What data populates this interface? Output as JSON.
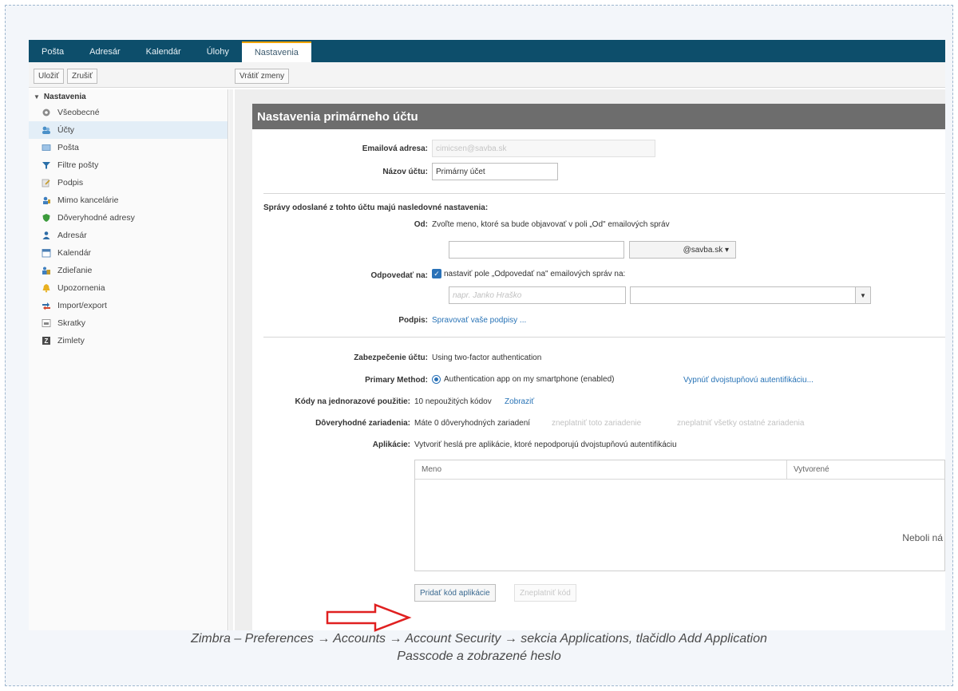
{
  "nav": {
    "tabs": [
      {
        "label": "Pošta"
      },
      {
        "label": "Adresár"
      },
      {
        "label": "Kalendár"
      },
      {
        "label": "Úlohy"
      },
      {
        "label": "Nastavenia"
      }
    ]
  },
  "toolbar": {
    "save_label": "Uložiť",
    "cancel_label": "Zrušiť",
    "revert_label": "Vrátiť zmeny"
  },
  "sidebar": {
    "header": "Nastavenia",
    "items": [
      {
        "label": "Všeobecné",
        "icon": "gear-icon"
      },
      {
        "label": "Účty",
        "icon": "accounts-icon"
      },
      {
        "label": "Pošta",
        "icon": "mail-icon"
      },
      {
        "label": "Filtre pošty",
        "icon": "filter-icon"
      },
      {
        "label": "Podpis",
        "icon": "signature-icon"
      },
      {
        "label": "Mimo kancelárie",
        "icon": "out-of-office-icon"
      },
      {
        "label": "Dôveryhodné adresy",
        "icon": "shield-icon"
      },
      {
        "label": "Adresár",
        "icon": "contacts-icon"
      },
      {
        "label": "Kalendár",
        "icon": "calendar-icon"
      },
      {
        "label": "Zdieľanie",
        "icon": "sharing-icon"
      },
      {
        "label": "Upozornenia",
        "icon": "bell-icon"
      },
      {
        "label": "Import/export",
        "icon": "import-export-icon"
      },
      {
        "label": "Skratky",
        "icon": "keyboard-icon"
      },
      {
        "label": "Zimlety",
        "icon": "zimlet-icon"
      }
    ]
  },
  "panel": {
    "title": "Nastavenia primárneho účtu",
    "email_label": "Emailová adresa:",
    "email_value": "cimicsen@savba.sk",
    "account_name_label": "Názov účtu:",
    "account_name_value": "Primárny účet",
    "sent_section": "Správy odoslané z tohto účtu majú nasledovné nastavenia:",
    "from_label": "Od:",
    "from_text": "Zvoľte meno, ktoré sa bude objavovať v poli „Od\" emailových správ",
    "domain_select": "@savba.sk ▾",
    "reply_to_label": "Odpovedať na:",
    "reply_to_text": "nastaviť pole „Odpovedať na\" emailových správ na:",
    "reply_placeholder": "napr. Janko Hraško",
    "signature_label": "Podpis:",
    "signature_link": "Spravovať vaše podpisy ...",
    "security_label": "Zabezpečenie účtu:",
    "security_value": "Using two-factor authentication",
    "primary_method_label": "Primary Method:",
    "primary_method_value": "Authentication app on my smartphone (enabled)",
    "disable_2fa_link": "Vypnúť dvojstupňovú autentifikáciu...",
    "codes_label": "Kódy na jednorazové použitie:",
    "codes_value": "10 nepoužitých kódov",
    "codes_link": "Zobraziť",
    "trusted_label": "Dôveryhodné zariadenia:",
    "trusted_value": "Máte 0 dôveryhodných zariadení",
    "trusted_link1": "zneplatniť toto zariadenie",
    "trusted_link2": "zneplatniť všetky ostatné zariadenia",
    "apps_label": "Aplikácie:",
    "apps_text": "Vytvoriť heslá pre aplikácie, ktoré nepodporujú dvojstupňovú autentifikáciu",
    "grid_col_name": "Meno",
    "grid_col_created": "Vytvorené",
    "grid_empty": "Neboli ná",
    "add_code_button": "Pridať kód aplikácie",
    "revoke_code_button": "Zneplatniť kód"
  },
  "caption": {
    "line1": "Zimbra – Preferences → Accounts → Account Security → sekcia Applications, tlačidlo Add Application",
    "line2": "Passcode a zobrazené heslo"
  },
  "colors": {
    "nav_bg": "#0d4e6b",
    "panel_title_bg": "#6d6d6d",
    "link": "#2873b6",
    "arrow": "#e02020"
  }
}
